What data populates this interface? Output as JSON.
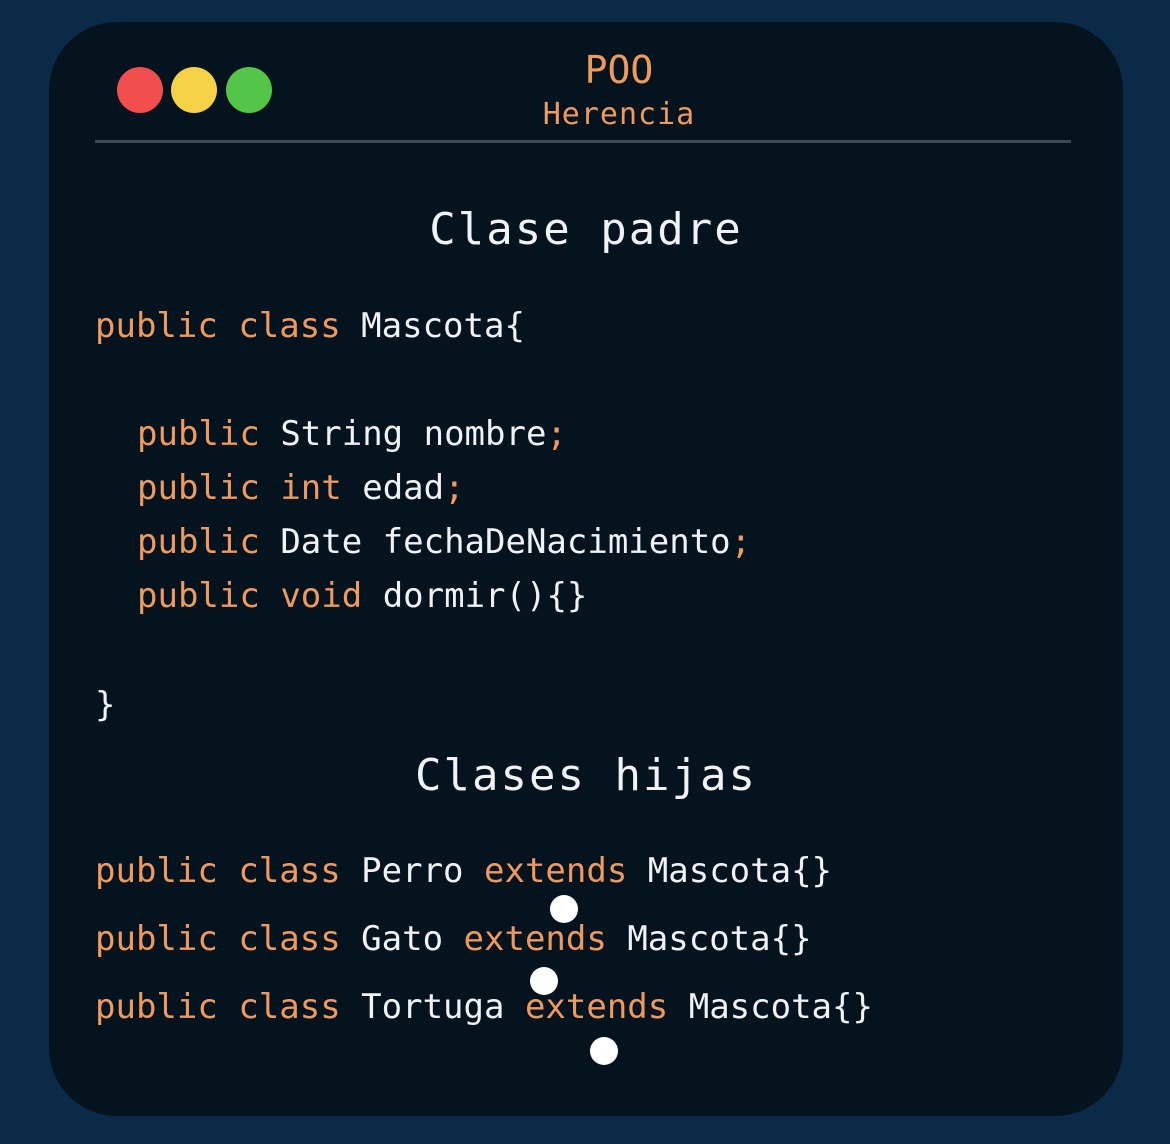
{
  "window": {
    "title": "POO",
    "subtitle": "Herencia",
    "controls": {
      "close_color": "#f34e4e",
      "minimize_color": "#f5d148",
      "maximize_color": "#53c548"
    }
  },
  "parent_section": {
    "heading": "Clase padre",
    "lines": [
      {
        "t1": "public",
        "t2": "class",
        "t3": "Mascota{"
      },
      {
        "t1": "public",
        "t2": "String nombre",
        "t3": ";"
      },
      {
        "t1": "public",
        "t2": "int",
        "t3": "edad",
        "t4": ";"
      },
      {
        "t1": "public",
        "t2": "Date fechaDeNacimiento",
        "t3": ";"
      },
      {
        "t1": "public",
        "t2": "void",
        "t3": "dormir(){}"
      },
      {
        "t1": "}"
      }
    ]
  },
  "children_section": {
    "heading": "Clases hijas",
    "lines": [
      {
        "t1": "public",
        "t2": "class",
        "t3": "Perro",
        "t4": "extends",
        "t5": "Mascota{}"
      },
      {
        "t1": "public",
        "t2": "class",
        "t3": "Gato",
        "t4": "extends",
        "t5": "Mascota{}"
      },
      {
        "t1": "public",
        "t2": "class",
        "t3": "Tortuga",
        "t4": "extends",
        "t5": "Mascota{}"
      }
    ]
  },
  "colors": {
    "background": "#0b2a48",
    "card": "#05131f",
    "keyword": "#ee9a5e",
    "text": "#f0f2f5",
    "marker": "#ffffff"
  }
}
